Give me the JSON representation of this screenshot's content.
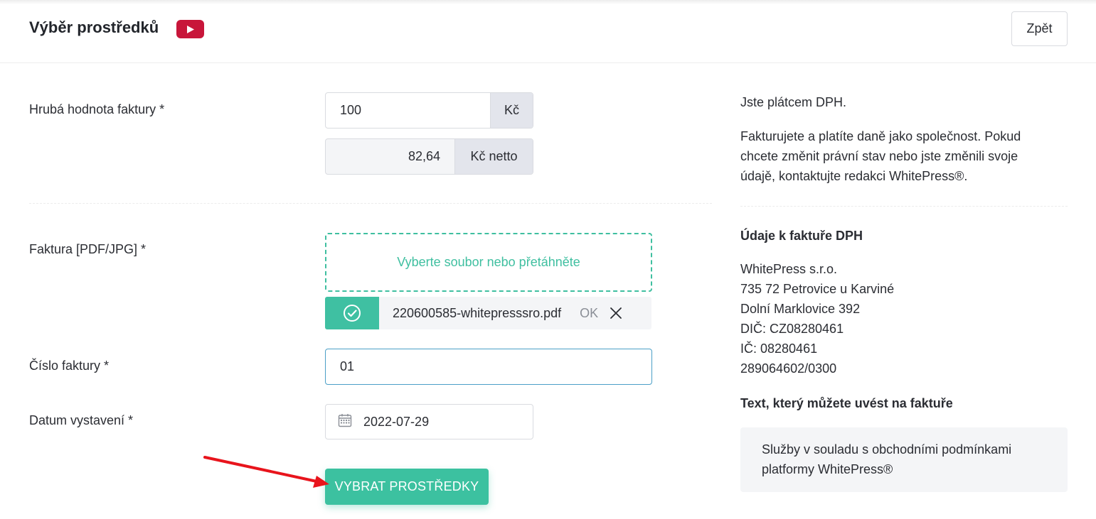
{
  "header": {
    "title": "Výběr prostředků",
    "back_label": "Zpět"
  },
  "form": {
    "gross": {
      "label": "Hrubá hodnota faktury  *",
      "value": "100",
      "unit": "Kč",
      "net_value": "82,64",
      "net_unit": "Kč netto"
    },
    "invoice_file": {
      "label": "Faktura [PDF/JPG] *",
      "dropzone_text": "Vyberte soubor nebo přetáhněte",
      "file_name": "220600585-whitepresssro.pdf",
      "file_status": "OK"
    },
    "invoice_number": {
      "label": "Číslo faktury *",
      "value": "01"
    },
    "issue_date": {
      "label": "Datum vystavení *",
      "value": "2022-07-29"
    },
    "submit_label": "VYBRAT PROSTŘEDKY"
  },
  "sidebar": {
    "vat_status": "Jste plátcem DPH.",
    "vat_info_lines": [
      "Fakturujete a platíte daně jako společnost. Pokud",
      "chcete změnit právní stav nebo jste změnili svoje",
      "údajě, kontaktujte redakci WhitePress®."
    ],
    "invoice_details_title": "Údaje k faktuře DPH",
    "invoice_details_lines": [
      "WhitePress s.r.o.",
      "735 72 Petrovice u Karviné",
      "Dolní Marklovice 392",
      "DIČ: CZ08280461",
      "IČ: 08280461",
      "289064602/0300"
    ],
    "invoice_text_title": "Text, který můžete uvést na faktuře",
    "invoice_text_lines": [
      "Služby v souladu s obchodními podmínkami",
      "platformy WhitePress®"
    ]
  },
  "colors": {
    "accent": "#3cc1a0",
    "youtube": "#c8163a",
    "arrow": "#e8141c",
    "focus_border": "#4b9fc7"
  },
  "icons": {
    "youtube": "youtube-icon",
    "check": "check-circle-icon",
    "close": "close-icon",
    "calendar": "calendar-icon"
  }
}
